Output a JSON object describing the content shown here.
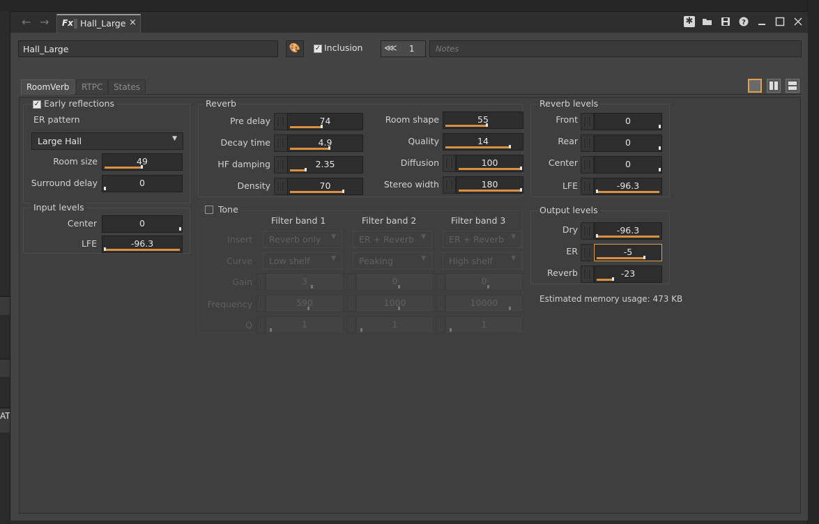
{
  "titlebar": {
    "tab_icon": "Fx",
    "tab_title": "Hall_Large",
    "tab_close": "×",
    "icons": [
      "pin-icon",
      "folder-open-icon",
      "save-icon",
      "help-icon",
      "minimize-icon",
      "maximize-icon",
      "close-icon"
    ]
  },
  "left_edge_text": "AT",
  "header": {
    "name": "Hall_Large",
    "inclusion_label": "Inclusion",
    "inclusion_checked": true,
    "share_count": "1",
    "notes_placeholder": "Notes"
  },
  "tabs": [
    "RoomVerb",
    "RTPC",
    "States"
  ],
  "active_tab": "RoomVerb",
  "early_reflections": {
    "label": "Early reflections",
    "checked": true,
    "er_pattern_label": "ER pattern",
    "er_pattern_value": "Large Hall",
    "room_size_label": "Room size",
    "room_size": "49",
    "surround_delay_label": "Surround delay",
    "surround_delay": "0"
  },
  "input_levels": {
    "title": "Input levels",
    "center_label": "Center",
    "center": "0",
    "lfe_label": "LFE",
    "lfe": "-96.3"
  },
  "reverb": {
    "title": "Reverb",
    "pre_delay_label": "Pre delay",
    "pre_delay": "74",
    "decay_time_label": "Decay time",
    "decay_time": "4.9",
    "hf_damping_label": "HF damping",
    "hf_damping": "2.35",
    "density_label": "Density",
    "density": "70",
    "room_shape_label": "Room shape",
    "room_shape": "55",
    "quality_label": "Quality",
    "quality": "14",
    "diffusion_label": "Diffusion",
    "diffusion": "100",
    "stereo_width_label": "Stereo width",
    "stereo_width": "180"
  },
  "tone": {
    "label": "Tone",
    "checked": false,
    "band1_title": "Filter band 1",
    "band2_title": "Filter band 2",
    "band3_title": "Filter band 3",
    "insert_label": "Insert",
    "curve_label": "Curve",
    "gain_label": "Gain",
    "frequency_label": "Frequency",
    "q_label": "Q",
    "band1": {
      "insert": "Reverb only",
      "curve": "Low shelf",
      "gain": "3",
      "frequency": "590",
      "q": "1"
    },
    "band2": {
      "insert": "ER + Reverb",
      "curve": "Peaking",
      "gain": "0",
      "frequency": "1000",
      "q": "1"
    },
    "band3": {
      "insert": "ER + Reverb",
      "curve": "High shelf",
      "gain": "0",
      "frequency": "10000",
      "q": "1"
    }
  },
  "reverb_levels": {
    "title": "Reverb levels",
    "front_label": "Front",
    "front": "0",
    "rear_label": "Rear",
    "rear": "0",
    "center_label": "Center",
    "center": "0",
    "lfe_label": "LFE",
    "lfe": "-96.3"
  },
  "output_levels": {
    "title": "Output levels",
    "dry_label": "Dry",
    "dry": "-96.3",
    "er_label": "ER",
    "er": "-5",
    "reverb_label": "Reverb",
    "reverb": "-23"
  },
  "memory_text": "Estimated memory usage: 473 KB",
  "colors": {
    "accent": "#d99040",
    "panel": "#3f3f3f",
    "field": "#2d2d2d"
  }
}
